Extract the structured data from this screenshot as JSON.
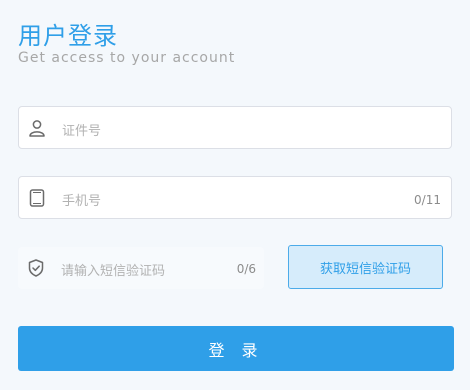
{
  "header": {
    "title": "用户登录",
    "subtitle": "Get access to your account"
  },
  "form": {
    "id_field": {
      "placeholder": "证件号",
      "icon": "user-icon"
    },
    "phone_field": {
      "placeholder": "手机号",
      "counter": "0/11",
      "icon": "phone-icon"
    },
    "code_field": {
      "placeholder": "请输入短信验证码",
      "counter": "0/6",
      "icon": "shield-icon"
    },
    "sms_button_label": "获取短信验证码",
    "login_button_label": "登 录"
  },
  "colors": {
    "accent": "#2f9fe8",
    "background": "#f4f8fc",
    "sms_button_bg": "#d6ecfb"
  }
}
